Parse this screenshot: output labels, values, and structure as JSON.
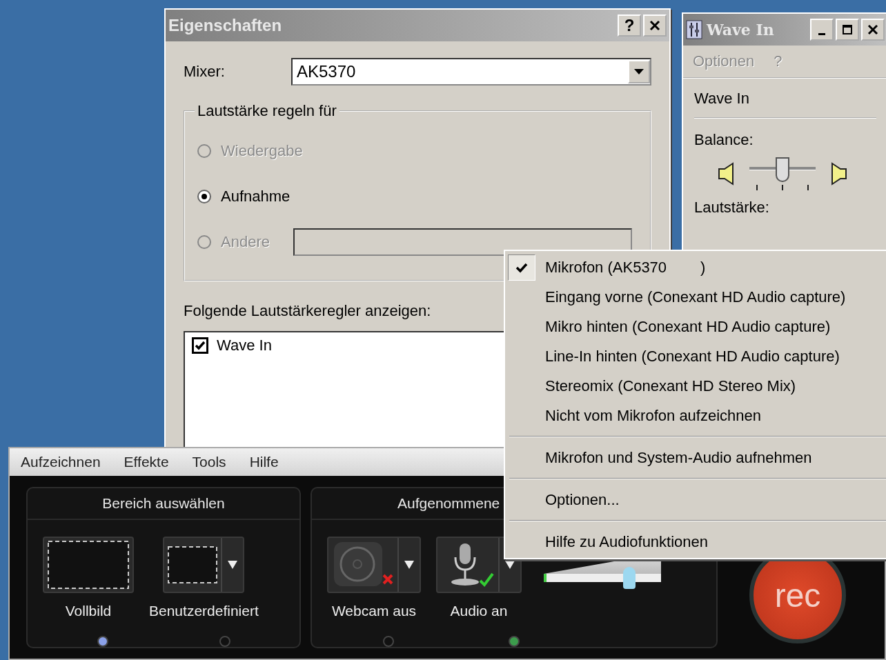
{
  "properties_dialog": {
    "title": "Eigenschaften",
    "help_button": "?",
    "mixer": {
      "label": "Mixer:",
      "value": "AK5370"
    },
    "volume_group": {
      "label": "Lautstärke regeln für",
      "options": [
        {
          "label": "Wiedergabe",
          "selected": false,
          "disabled": true
        },
        {
          "label": "Aufnahme",
          "selected": true,
          "disabled": false
        },
        {
          "label": "Andere",
          "selected": false,
          "disabled": true
        }
      ]
    },
    "controls_label": "Folgende Lautstärkeregler anzeigen:",
    "controls": [
      {
        "label": "Wave In",
        "checked": true
      }
    ]
  },
  "wave_in_window": {
    "title": "Wave In",
    "menu": [
      {
        "label": "Optionen",
        "disabled": true
      },
      {
        "label": "?",
        "disabled": true
      }
    ],
    "channel": "Wave In",
    "balance_label": "Balance:",
    "balance": {
      "level": 0.5
    },
    "volume_label": "Lautstärke:"
  },
  "recorder": {
    "menu": [
      "Aufzeichnen",
      "Effekte",
      "Tools",
      "Hilfe"
    ],
    "panels": [
      {
        "title": "Bereich auswählen",
        "options": [
          {
            "label": "Vollbild",
            "kind": "fullscreen",
            "selected": true,
            "dropdown": false
          },
          {
            "label": "Benutzerdefiniert",
            "kind": "custom",
            "selected": false,
            "dropdown": true
          }
        ]
      },
      {
        "title": "Aufgenommene",
        "options": [
          {
            "label": "Webcam aus",
            "kind": "webcam",
            "on": false,
            "selected": false,
            "dropdown": true
          },
          {
            "label": "Audio an",
            "kind": "microphone",
            "on": true,
            "selected": true,
            "dropdown": true
          }
        ],
        "volume": {
          "level": 0.72
        }
      }
    ],
    "rec_button": "rec"
  },
  "context_menu": [
    {
      "kind": "item",
      "label": "Mikrofon (AK5370        )",
      "checked": true
    },
    {
      "kind": "item",
      "label": "Eingang vorne (Conexant HD Audio capture)",
      "checked": false
    },
    {
      "kind": "item",
      "label": "Mikro hinten (Conexant HD Audio capture)",
      "checked": false
    },
    {
      "kind": "item",
      "label": "Line-In hinten (Conexant HD Audio capture)",
      "checked": false
    },
    {
      "kind": "item",
      "label": "Stereomix (Conexant HD Stereo Mix)",
      "checked": false
    },
    {
      "kind": "item",
      "label": "Nicht vom Mikrofon aufzeichnen",
      "checked": false
    },
    {
      "kind": "separator"
    },
    {
      "kind": "item",
      "label": "Mikrofon und System-Audio aufnehmen",
      "checked": false
    },
    {
      "kind": "separator"
    },
    {
      "kind": "item",
      "label": "Optionen...",
      "checked": false
    },
    {
      "kind": "separator"
    },
    {
      "kind": "item",
      "label": "Hilfe zu Audiofunktionen",
      "checked": false
    }
  ]
}
